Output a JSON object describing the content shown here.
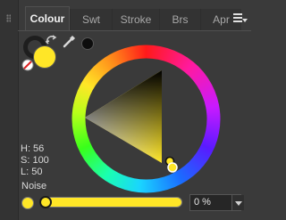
{
  "tabs": [
    {
      "label": "Colour",
      "active": true
    },
    {
      "label": "Swt",
      "active": false
    },
    {
      "label": "Stroke",
      "active": false
    },
    {
      "label": "Brs",
      "active": false
    },
    {
      "label": "Apr",
      "active": false
    }
  ],
  "fill_color": "#ffe627",
  "stroke_color": "#1e1e1e",
  "picked_color": "#0d0d0d",
  "hsl": {
    "h": "H: 56",
    "s": "S: 100",
    "l": "L: 50"
  },
  "noise": {
    "label": "Noise",
    "value": "0 %",
    "level": 0
  },
  "icons": {
    "menu": "hamburger-menu-icon",
    "swap": "swap-arrow-icon",
    "none": "no-color-icon",
    "picker": "eyedropper-icon",
    "dropdown": "chevron-down-icon"
  }
}
